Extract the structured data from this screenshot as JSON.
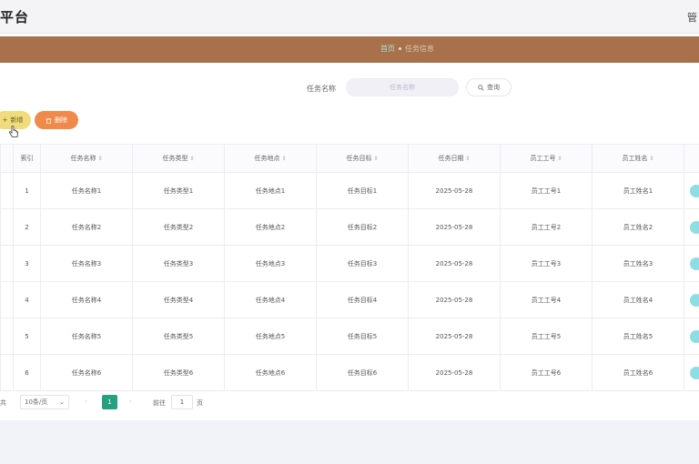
{
  "header": {
    "title": "平台",
    "right_text": "管"
  },
  "breadcrumb": {
    "home": "首页",
    "current": "任务信息"
  },
  "search": {
    "label": "任务名称",
    "placeholder": "任务名称",
    "button": "查询"
  },
  "actions": {
    "add": "新增",
    "delete": "删除"
  },
  "table": {
    "columns": [
      "索引",
      "任务名称",
      "任务类型",
      "任务地点",
      "任务目标",
      "任务日期",
      "员工工号",
      "员工姓名"
    ],
    "rows": [
      [
        "1",
        "任务名称1",
        "任务类型1",
        "任务地点1",
        "任务目标1",
        "2025-05-28",
        "员工工号1",
        "员工姓名1"
      ],
      [
        "2",
        "任务名称2",
        "任务类型2",
        "任务地点2",
        "任务目标2",
        "2025-05-28",
        "员工工号2",
        "员工姓名2"
      ],
      [
        "3",
        "任务名称3",
        "任务类型3",
        "任务地点3",
        "任务目标3",
        "2025-05-28",
        "员工工号3",
        "员工姓名3"
      ],
      [
        "4",
        "任务名称4",
        "任务类型4",
        "任务地点4",
        "任务目标4",
        "2025-05-28",
        "员工工号4",
        "员工姓名4"
      ],
      [
        "5",
        "任务名称5",
        "任务类型5",
        "任务地点5",
        "任务目标5",
        "2025-05-28",
        "员工工号5",
        "员工姓名5"
      ],
      [
        "6",
        "任务名称6",
        "任务类型6",
        "任务地点6",
        "任务目标6",
        "2025-05-28",
        "员工工号6",
        "员工姓名6"
      ]
    ]
  },
  "pagination": {
    "total_label": "共",
    "page_size": "10条/页",
    "current_page": "1",
    "goto_label": "前往",
    "goto_value": "1",
    "page_unit": "页"
  },
  "icons": {
    "prev": "chevron-left-icon",
    "next": "chevron-right-icon",
    "search": "search-icon",
    "add": "plus-icon",
    "delete": "trash-icon",
    "cursor": "hand-cursor-icon"
  },
  "colors": {
    "banner": "#a8714c",
    "add_button": "#f1dc7d",
    "delete_button": "#f08a4b",
    "active_page": "#26a17f",
    "row_action": "#8fdde4"
  }
}
